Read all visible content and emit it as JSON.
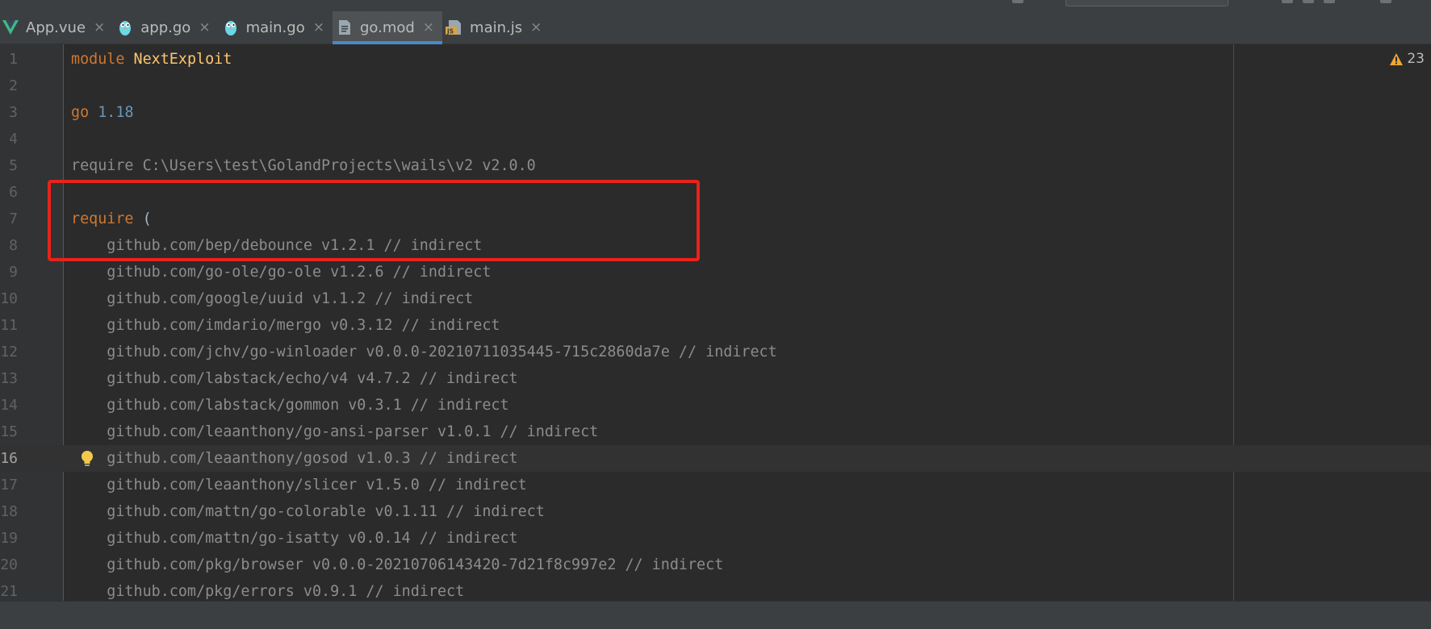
{
  "tabs": [
    {
      "label": "App.vue",
      "icon": "vue-icon",
      "active": false
    },
    {
      "label": "app.go",
      "icon": "gopher-icon",
      "active": false
    },
    {
      "label": "main.go",
      "icon": "gopher-icon",
      "active": false
    },
    {
      "label": "go.mod",
      "icon": "file-icon",
      "active": true
    },
    {
      "label": "main.js",
      "icon": "js-file-icon",
      "active": false
    }
  ],
  "tab_close_glyph": "×",
  "colors": {
    "accent": "#4a88c7",
    "highlight_box": "#e8231a",
    "warning": "#f0a732",
    "keyword": "#cc7832",
    "module_name": "#ffc66d",
    "number": "#6897bb"
  },
  "editor": {
    "warnings_count": "23",
    "current_line": 16,
    "lines": [
      {
        "n": "1",
        "tokens": [
          {
            "t": "module",
            "c": "kw"
          },
          {
            "t": " "
          },
          {
            "t": "NextExploit",
            "c": "mod"
          }
        ]
      },
      {
        "n": "2",
        "tokens": []
      },
      {
        "n": "3",
        "tokens": [
          {
            "t": "go",
            "c": "kw"
          },
          {
            "t": " "
          },
          {
            "t": "1.18",
            "c": "num"
          }
        ]
      },
      {
        "n": "4",
        "tokens": []
      },
      {
        "n": "5",
        "tokens": [
          {
            "t": "require C:\\Users\\test\\GolandProjects\\wails\\v2 v2.0.0",
            "c": "gray"
          }
        ]
      },
      {
        "n": "6",
        "tokens": []
      },
      {
        "n": "7",
        "tokens": [
          {
            "t": "require",
            "c": "kw"
          },
          {
            "t": " ("
          }
        ]
      },
      {
        "n": "8",
        "tokens": [
          {
            "t": "    github.com/bep/debounce v1.2.1 // indirect",
            "c": "gray"
          }
        ]
      },
      {
        "n": "9",
        "tokens": [
          {
            "t": "    github.com/go-ole/go-ole v1.2.6 // indirect",
            "c": "gray"
          }
        ]
      },
      {
        "n": "10",
        "tokens": [
          {
            "t": "    github.com/google/uuid v1.1.2 // indirect",
            "c": "gray"
          }
        ]
      },
      {
        "n": "11",
        "tokens": [
          {
            "t": "    github.com/imdario/mergo v0.3.12 // indirect",
            "c": "gray"
          }
        ]
      },
      {
        "n": "12",
        "tokens": [
          {
            "t": "    github.com/jchv/go-winloader v0.0.0-20210711035445-715c2860da7e // indirect",
            "c": "gray"
          }
        ]
      },
      {
        "n": "13",
        "tokens": [
          {
            "t": "    github.com/labstack/echo/v4 v4.7.2 // indirect",
            "c": "gray"
          }
        ]
      },
      {
        "n": "14",
        "tokens": [
          {
            "t": "    github.com/labstack/gommon v0.3.1 // indirect",
            "c": "gray"
          }
        ]
      },
      {
        "n": "15",
        "tokens": [
          {
            "t": "    github.com/leaanthony/go-ansi-parser v1.0.1 // indirect",
            "c": "gray"
          }
        ]
      },
      {
        "n": "16",
        "tokens": [
          {
            "t": "    github.com/leaanthony/gosod v1.0.3 // indirect",
            "c": "gray"
          }
        ]
      },
      {
        "n": "17",
        "tokens": [
          {
            "t": "    github.com/leaanthony/slicer v1.5.0 // indirect",
            "c": "gray"
          }
        ]
      },
      {
        "n": "18",
        "tokens": [
          {
            "t": "    github.com/mattn/go-colorable v0.1.11 // indirect",
            "c": "gray"
          }
        ]
      },
      {
        "n": "19",
        "tokens": [
          {
            "t": "    github.com/mattn/go-isatty v0.0.14 // indirect",
            "c": "gray"
          }
        ]
      },
      {
        "n": "20",
        "tokens": [
          {
            "t": "    github.com/pkg/browser v0.0.0-20210706143420-7d21f8c997e2 // indirect",
            "c": "gray"
          }
        ]
      },
      {
        "n": "21",
        "tokens": [
          {
            "t": "    github.com/pkg/errors v0.9.1 // indirect",
            "c": "gray"
          }
        ]
      }
    ]
  }
}
